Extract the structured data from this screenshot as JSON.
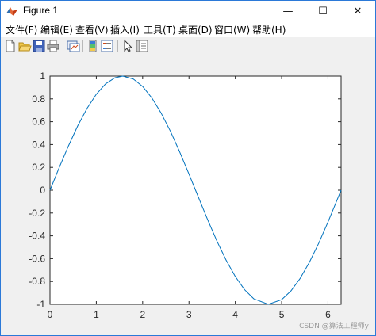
{
  "window": {
    "title": "Figure 1",
    "controls": {
      "minimize": "—",
      "maximize": "☐",
      "close": "✕"
    }
  },
  "menu": [
    {
      "label": "文件(F)"
    },
    {
      "label": "编辑(E)"
    },
    {
      "label": "查看(V)"
    },
    {
      "label": "插入(I)"
    },
    {
      "label": "工具(T)"
    },
    {
      "label": "桌面(D)"
    },
    {
      "label": "窗口(W)"
    },
    {
      "label": "帮助(H)"
    }
  ],
  "toolbar": [
    {
      "icon": "new-figure-icon"
    },
    {
      "icon": "open-file-icon"
    },
    {
      "icon": "save-icon"
    },
    {
      "icon": "print-icon"
    },
    {
      "icon": "link-plot-icon"
    },
    {
      "icon": "insert-colorbar-icon"
    },
    {
      "icon": "insert-legend-icon"
    },
    {
      "icon": "edit-plot-icon"
    },
    {
      "icon": "property-inspector-icon"
    }
  ],
  "watermark": "CSDN @算法工程师y",
  "chart_data": {
    "type": "line",
    "title": "",
    "xlabel": "",
    "ylabel": "",
    "xlim": [
      0,
      6.2832
    ],
    "ylim": [
      -1,
      1
    ],
    "xticks": [
      "0",
      "1",
      "2",
      "3",
      "4",
      "5",
      "6"
    ],
    "yticks": [
      "-1",
      "-0.8",
      "-0.6",
      "-0.4",
      "-0.2",
      "0",
      "0.2",
      "0.4",
      "0.6",
      "0.8",
      "1"
    ],
    "grid": false,
    "line_color": "#0072bd",
    "series": [
      {
        "x": [
          0,
          0.2,
          0.4,
          0.6,
          0.8,
          1.0,
          1.2,
          1.4,
          1.5708,
          1.8,
          2.0,
          2.2,
          2.4,
          2.6,
          2.8,
          3.0,
          3.1416,
          3.4,
          3.6,
          3.8,
          4.0,
          4.2,
          4.4,
          4.7124,
          5.0,
          5.2,
          5.4,
          5.6,
          5.8,
          6.0,
          6.2832
        ],
        "y": [
          0,
          0.199,
          0.389,
          0.565,
          0.717,
          0.841,
          0.932,
          0.985,
          1.0,
          0.974,
          0.909,
          0.808,
          0.675,
          0.516,
          0.335,
          0.141,
          0,
          -0.256,
          -0.443,
          -0.612,
          -0.757,
          -0.872,
          -0.952,
          -1.0,
          -0.959,
          -0.883,
          -0.773,
          -0.631,
          -0.465,
          -0.279,
          0
        ]
      }
    ]
  }
}
